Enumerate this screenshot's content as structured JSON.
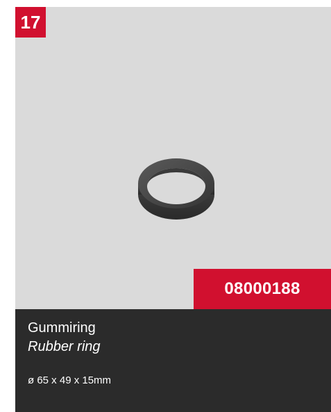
{
  "product": {
    "index": "17",
    "sku": "08000188",
    "name_primary": "Gummiring",
    "name_secondary": "Rubber ring",
    "dimensions": "ø 65 x 49 x 15mm",
    "image_icon": "rubber-ring-icon"
  },
  "colors": {
    "accent": "#d1102f",
    "image_background": "#dadada",
    "panel_background": "#2b2b2b",
    "text": "#ffffff"
  }
}
